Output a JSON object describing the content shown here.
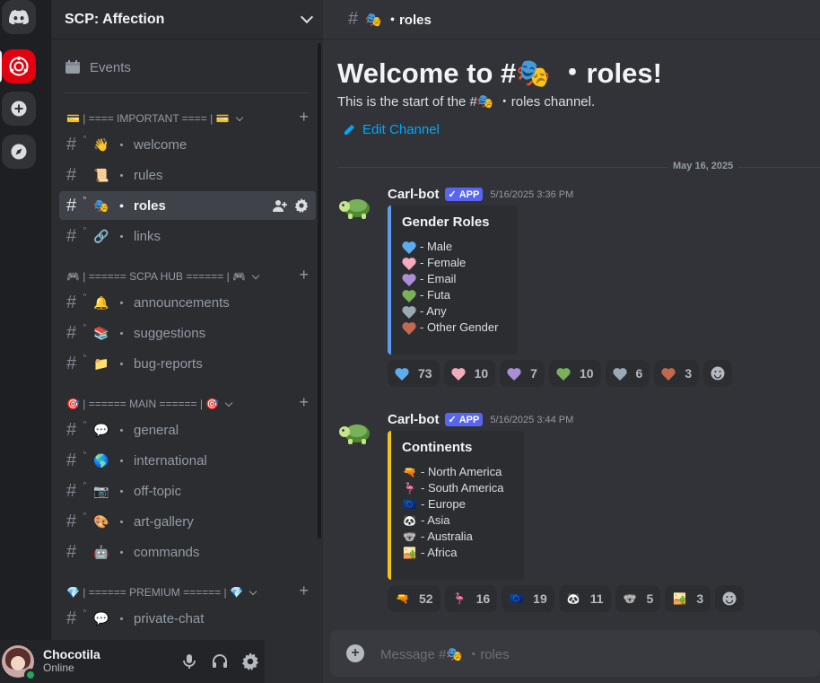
{
  "server": {
    "name": "SCP: Affection"
  },
  "sidebar": {
    "events_label": "Events",
    "categories": [
      {
        "name": "💳 | ==== IMPORTANT ==== | 💳"
      },
      {
        "name": "🎮 | ====== SCPA HUB ====== | 🎮"
      },
      {
        "name": "🎯 | ====== MAIN ====== | 🎯"
      },
      {
        "name": "💎 | ====== PREMIUM ====== | 💎"
      }
    ],
    "channels": [
      {
        "emoji": "👋",
        "name": "welcome"
      },
      {
        "emoji": "📜",
        "name": "rules"
      },
      {
        "emoji": "🎭",
        "name": "roles"
      },
      {
        "emoji": "🔗",
        "name": "links"
      },
      {
        "emoji": "🔔",
        "name": "announcements"
      },
      {
        "emoji": "📚",
        "name": "suggestions"
      },
      {
        "emoji": "📁",
        "name": "bug-reports"
      },
      {
        "emoji": "💬",
        "name": "general"
      },
      {
        "emoji": "🌎",
        "name": "international"
      },
      {
        "emoji": "📷",
        "name": "off-topic"
      },
      {
        "emoji": "🎨",
        "name": "art-gallery"
      },
      {
        "emoji": "🤖",
        "name": "commands"
      },
      {
        "emoji": "💬",
        "name": "private-chat"
      }
    ]
  },
  "user": {
    "name": "Chocotila",
    "status": "Online"
  },
  "channel": {
    "topbar_name": "🎭 ・roles",
    "welcome_title": "Welcome to #🎭 ・roles!",
    "welcome_sub": "This is the start of the #🎭 ・roles channel.",
    "edit_label": "Edit Channel",
    "date_divider": "May 16, 2025",
    "composer_placeholder": "Message #🎭 ・roles"
  },
  "messages": [
    {
      "author": "Carl-bot",
      "badge": "APP",
      "time": "5/16/2025 3:36 PM",
      "embed_color": "#5e9ced",
      "embed_title": "Gender Roles",
      "lines": [
        {
          "icon": "blue-heart",
          "color": "#5dadec",
          "text": "- Male"
        },
        {
          "icon": "pink-heart",
          "color": "#f4abba",
          "text": "- Female"
        },
        {
          "icon": "purple-heart",
          "color": "#aa8ed6",
          "text": "- Email"
        },
        {
          "icon": "green-heart",
          "color": "#78b159",
          "text": "- Futa"
        },
        {
          "icon": "grey-heart",
          "color": "#99aab5",
          "text": "- Any"
        },
        {
          "icon": "brown-heart",
          "color": "#c1694f",
          "text": "- Other Gender"
        }
      ],
      "reactions": [
        {
          "color": "#5dadec",
          "count": "73"
        },
        {
          "color": "#f4abba",
          "count": "10"
        },
        {
          "color": "#aa8ed6",
          "count": "7"
        },
        {
          "color": "#78b159",
          "count": "10"
        },
        {
          "color": "#99aab5",
          "count": "6"
        },
        {
          "color": "#c1694f",
          "count": "3"
        }
      ]
    },
    {
      "author": "Carl-bot",
      "badge": "APP",
      "time": "5/16/2025 3:44 PM",
      "embed_color": "#f0c419",
      "embed_title": "Continents",
      "lines": [
        {
          "icon": "🔫",
          "text": "- North America"
        },
        {
          "icon": "🦩",
          "text": "- South America"
        },
        {
          "icon": "🇪🇺",
          "text": "- Europe"
        },
        {
          "icon": "🐼",
          "text": "- Asia"
        },
        {
          "icon": "🐨",
          "text": "- Australia"
        },
        {
          "icon": "🏜️",
          "text": "- Africa"
        }
      ],
      "reactions": [
        {
          "icon": "🔫",
          "count": "52"
        },
        {
          "icon": "🦩",
          "count": "16"
        },
        {
          "icon": "🇪🇺",
          "count": "19"
        },
        {
          "icon": "🐼",
          "count": "11"
        },
        {
          "icon": "🐨",
          "count": "5"
        },
        {
          "icon": "🏜️",
          "count": "3"
        }
      ]
    }
  ],
  "colors": {
    "accent": "#5865f2",
    "link": "#00a8fc",
    "online": "#23a55a",
    "brand_server": "#e3000f"
  }
}
